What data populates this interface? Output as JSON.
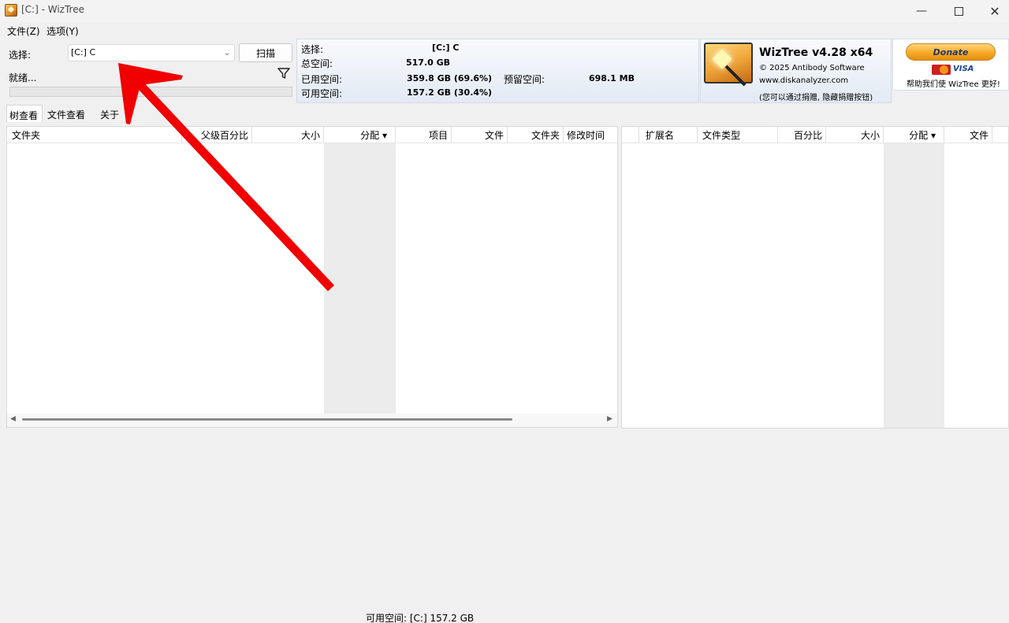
{
  "window": {
    "title": "[C:]  - WizTree",
    "controls": [
      "minimize-icon",
      "maximize-icon",
      "close-icon"
    ]
  },
  "menu": {
    "file": "文件(Z)",
    "options": "选项(Y)"
  },
  "toolbar": {
    "select_label": "选择:",
    "drive_value": "[C:] C",
    "scan_label": "扫描",
    "status": "就绪...",
    "filter_icon": "filter-icon"
  },
  "info": {
    "select_label": "选择:",
    "select_value": "[C:]  C",
    "total_label": "总空间:",
    "total_value": "517.0 GB",
    "used_label": "已用空间:",
    "used_value": "359.8 GB  (69.6%)",
    "reserved_label": "预留空间:",
    "reserved_value": "698.1 MB",
    "free_label": "可用空间:",
    "free_value": "157.2 GB  (30.4%)"
  },
  "brand": {
    "name": "WizTree v4.28 x64",
    "copyright": "© 2025 Antibody Software",
    "website": "www.diskanalyzer.com",
    "note": "(您可以通过捐赠, 隐藏捐赠按钮)"
  },
  "donate": {
    "button": "Donate",
    "card_brand": "VISA",
    "text": "帮助我们使 WizTree 更好!"
  },
  "tabs": [
    "树查看",
    "文件查看",
    "关于"
  ],
  "tree_columns": [
    "文件夹",
    "父级百分比",
    "大小",
    "分配 ▾",
    "项目",
    "文件",
    "文件夹",
    "修改时间"
  ],
  "ext_columns": [
    "扩展名",
    "文件类型",
    "百分比",
    "大小",
    "分配 ▾",
    "文件"
  ],
  "statusbar": {
    "free_text": "可用空间: [C:] 157.2 GB"
  },
  "colors": {
    "annotation_arrow": "#f00000",
    "panel_gradient_top": "#f8fafd",
    "panel_gradient_bottom": "#e3eaf4"
  }
}
